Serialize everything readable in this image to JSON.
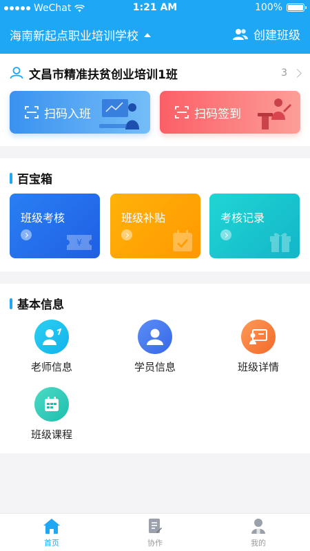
{
  "status_bar": {
    "carrier": "WeChat",
    "time": "1:21 AM",
    "battery": "100%"
  },
  "nav": {
    "school_name": "海南新起点职业培训学校",
    "create_class_label": "创建班级"
  },
  "class_card": {
    "class_name": "文昌市精准扶贫创业培训1班",
    "class_count": "3",
    "scan_join_label": "扫码入班",
    "scan_sign_label": "扫码签到"
  },
  "toolbox": {
    "title": "百宝箱",
    "items": [
      {
        "label": "班级考核"
      },
      {
        "label": "班级补贴"
      },
      {
        "label": "考核记录"
      }
    ]
  },
  "basic_info": {
    "title": "基本信息",
    "items": [
      {
        "label": "老师信息"
      },
      {
        "label": "学员信息"
      },
      {
        "label": "班级详情"
      },
      {
        "label": "班级课程"
      }
    ]
  },
  "tabs": [
    {
      "label": "首页",
      "active": true
    },
    {
      "label": "协作",
      "active": false
    },
    {
      "label": "我的",
      "active": false
    }
  ],
  "colors": {
    "primary": "#1ea7f5",
    "scan_join": "#3a92f0",
    "scan_sign": "#fb5f66",
    "exam_card": "#2a7ff4",
    "subsidy_card": "#ffb20a",
    "record_card": "#21d5d4"
  }
}
